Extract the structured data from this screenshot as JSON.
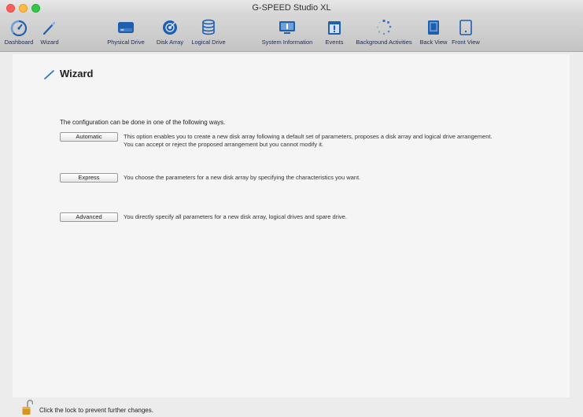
{
  "window": {
    "title": "G-SPEED Studio XL"
  },
  "toolbar": {
    "items": [
      {
        "label": "Dashboard",
        "icon": "dashboard-gauge-icon"
      },
      {
        "label": "Wizard",
        "icon": "wand-icon"
      },
      {
        "label": "Physical Drive",
        "icon": "physical-drive-icon"
      },
      {
        "label": "Disk Array",
        "icon": "disk-array-icon"
      },
      {
        "label": "Logical Drive",
        "icon": "logical-drive-icon"
      },
      {
        "label": "System Information",
        "icon": "system-info-icon"
      },
      {
        "label": "Events",
        "icon": "events-icon"
      },
      {
        "label": "Background Activities",
        "icon": "background-activities-spinner-icon"
      },
      {
        "label": "Back View",
        "icon": "back-view-icon"
      },
      {
        "label": "Front View",
        "icon": "front-view-icon"
      }
    ]
  },
  "page": {
    "title": "Wizard",
    "intro": "The configuration can be done in one of the following ways.",
    "options": [
      {
        "label": "Automatic",
        "description": "This option enables you to create a new disk array following a default set of parameters, proposes a disk array and logical drive arrangement. You can accept or reject the proposed arrangement but you cannot modify it."
      },
      {
        "label": "Express",
        "description": "You choose the parameters for a new disk array by specifying the characteristics you want."
      },
      {
        "label": "Advanced",
        "description": "You directly specify all parameters for a new disk array, logical drives and spare drive."
      }
    ]
  },
  "status": {
    "lock_text": "Click the lock to prevent further changes.",
    "lock_icon": "lock-open-icon"
  },
  "colors": {
    "accent": "#2a6bc4",
    "icon_blue": "#1f5fae",
    "window_bg": "#ececec",
    "content_bg": "#f5f5f5"
  }
}
